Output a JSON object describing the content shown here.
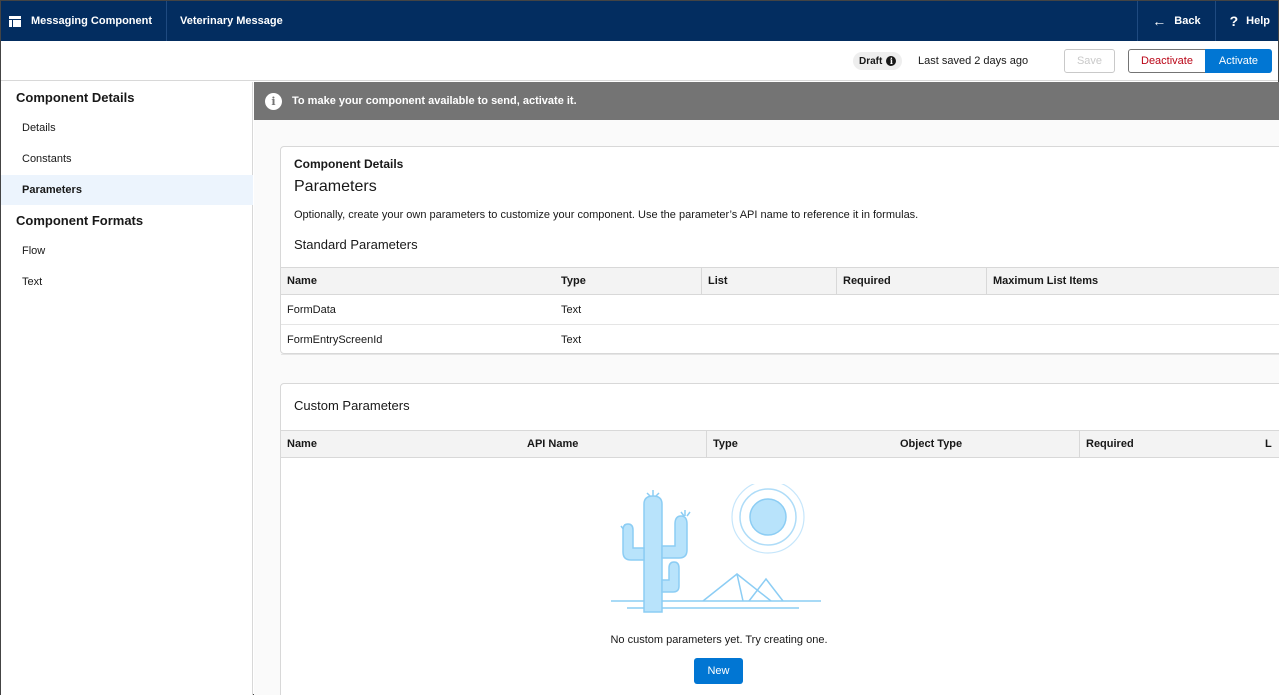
{
  "topbar": {
    "app_name": "Messaging Component",
    "record_name": "Veterinary Message",
    "back_label": "Back",
    "help_label": "Help"
  },
  "status": {
    "badge": "Draft",
    "last_saved": "Last saved 2 days ago",
    "save_label": "Save",
    "deactivate_label": "Deactivate",
    "activate_label": "Activate"
  },
  "sidebar": {
    "heading1": "Component Details",
    "items1": [
      "Details",
      "Constants",
      "Parameters"
    ],
    "heading2": "Component Formats",
    "items2": [
      "Flow",
      "Text"
    ],
    "active": "Parameters"
  },
  "banner": {
    "text": "To make your component available to send, activate it."
  },
  "standard": {
    "eyebrow": "Component Details",
    "title": "Parameters",
    "description": "Optionally, create your own parameters to customize your component. Use the parameter’s API name to reference it in formulas.",
    "subtitle": "Standard Parameters",
    "columns": [
      "Name",
      "Type",
      "List",
      "Required",
      "Maximum List Items"
    ],
    "rows": [
      {
        "name": "FormData",
        "type": "Text"
      },
      {
        "name": "FormEntryScreenId",
        "type": "Text"
      }
    ]
  },
  "custom": {
    "subtitle": "Custom Parameters",
    "columns": [
      "Name",
      "API Name",
      "Type",
      "Object Type",
      "Required",
      "L"
    ],
    "empty_text": "No custom parameters yet. Try creating one.",
    "new_label": "New"
  },
  "colors": {
    "brand_navy": "#032d60",
    "brand_blue": "#0176d3",
    "destructive": "#ba0517",
    "illustration": "#b8e3fb"
  }
}
